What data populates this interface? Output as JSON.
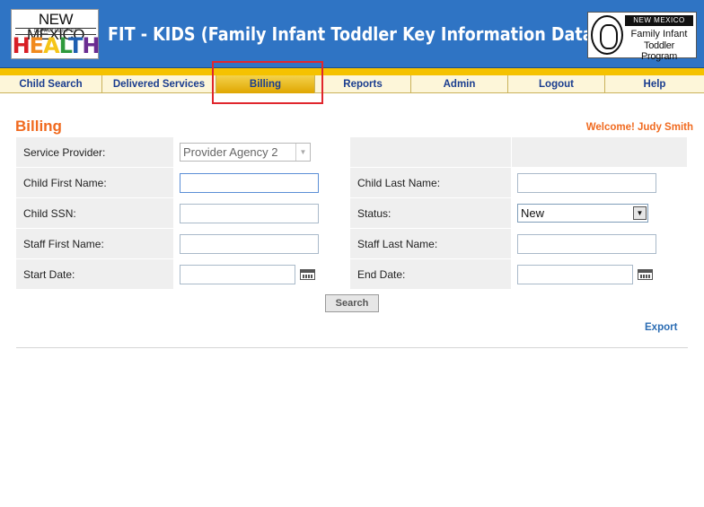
{
  "header": {
    "logo_left": {
      "line1": "NEW MEXICO",
      "line2": "DEPARTMENT OF",
      "line3_letters": [
        "H",
        "E",
        "A",
        "L",
        "T",
        "H"
      ]
    },
    "title": "FIT - KIDS (Family Infant Toddler Key Information Data System)",
    "logo_right": {
      "banner": "NEW MEXICO",
      "line1": "Family Infant",
      "line2": "Toddler Program"
    }
  },
  "nav": {
    "items": [
      {
        "label": "Child Search",
        "active": false
      },
      {
        "label": "Delivered Services",
        "active": false
      },
      {
        "label": "Billing",
        "active": true
      },
      {
        "label": "Reports",
        "active": false
      },
      {
        "label": "Admin",
        "active": false
      },
      {
        "label": "Logout",
        "active": false
      },
      {
        "label": "Help",
        "active": false
      }
    ]
  },
  "page": {
    "title": "Billing",
    "welcome": "Welcome! Judy Smith"
  },
  "form": {
    "service_provider_label": "Service Provider:",
    "service_provider_value": "Provider Agency 2",
    "child_first_name_label": "Child First Name:",
    "child_first_name_value": "",
    "child_last_name_label": "Child Last Name:",
    "child_last_name_value": "",
    "child_ssn_label": "Child SSN:",
    "child_ssn_value": "",
    "status_label": "Status:",
    "status_value": "New",
    "staff_first_name_label": "Staff First Name:",
    "staff_first_name_value": "",
    "staff_last_name_label": "Staff Last Name:",
    "staff_last_name_value": "",
    "start_date_label": "Start Date:",
    "start_date_value": "",
    "end_date_label": "End Date:",
    "end_date_value": ""
  },
  "actions": {
    "search_label": "Search",
    "export_label": "Export"
  },
  "icons": {
    "calendar": "calendar-icon",
    "dropdown": "chevron-down-icon"
  },
  "colors": {
    "header_blue": "#2f74c4",
    "nav_yellow": "#f5c200",
    "accent_orange": "#f06a1f",
    "link_blue": "#2b6cb3",
    "highlight_red": "#e0262d"
  }
}
